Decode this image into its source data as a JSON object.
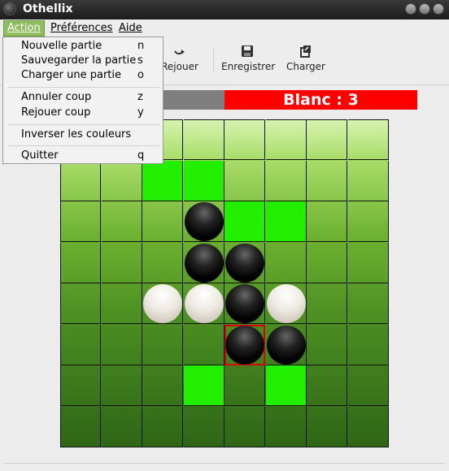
{
  "window": {
    "title": "Othellix"
  },
  "menubar": {
    "action": "Action",
    "preferences": "Préférences",
    "aide": "Aide"
  },
  "menu": {
    "items": [
      {
        "label": "Nouvelle partie",
        "key": "n"
      },
      {
        "label": "Sauvegarder la partie",
        "key": "s"
      },
      {
        "label": "Charger une partie",
        "key": "o"
      },
      {
        "label": "Annuler coup",
        "key": "z"
      },
      {
        "label": "Rejouer coup",
        "key": "y"
      },
      {
        "label": "Inverser les couleurs",
        "key": ""
      },
      {
        "label": "Quitter",
        "key": "q"
      }
    ]
  },
  "toolbar": {
    "rejouer": "Rejouer",
    "enregistrer": "Enregistrer",
    "charger": "Charger"
  },
  "score": {
    "label": "Blanc : 3"
  },
  "colors": {
    "playable": "#22ee00",
    "score_active": "#ff0000",
    "score_idle": "#7f7f7f",
    "last_move": "#dd0000"
  },
  "board": {
    "size": 8,
    "rows": [
      "........",
      "..pp....",
      "...Bpp..",
      "...BB...",
      "..WWBW..",
      "....BB..",
      "...p.p..",
      "........"
    ],
    "last_move": [
      5,
      4
    ]
  }
}
